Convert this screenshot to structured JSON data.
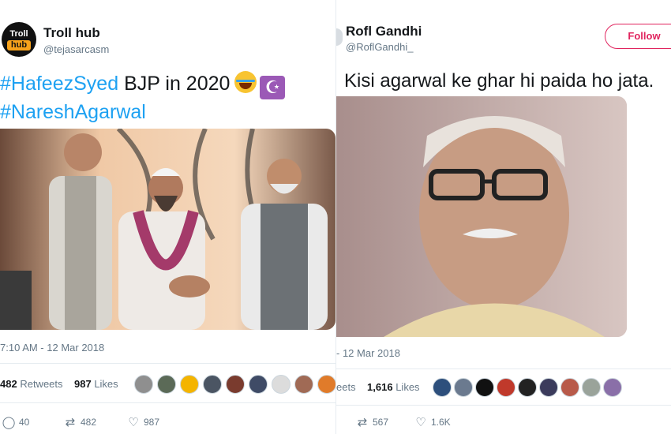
{
  "left_tweet": {
    "user_name": "Troll hub",
    "handle": "@tejasarcasm",
    "avatar_top_text": "Troll",
    "avatar_bottom_text": "hub",
    "hashtag_1": "#HafeezSyed",
    "text_after_hashtag": "BJP in 2020",
    "emoji_1": "face-with-tears-of-joy-icon",
    "emoji_2": "star-and-crescent-icon",
    "hashtag_2": "#NareshAgarwal",
    "timestamp": "7:10 AM - 12 Mar 2018",
    "retweets_count": "482",
    "retweets_label": "Retweets",
    "likes_count": "987",
    "likes_label": "Likes",
    "replies": "40",
    "retweets_action": "482",
    "likes_action": "987"
  },
  "right_tweet": {
    "user_name": "Rofl Gandhi",
    "handle": "@RoflGandhi_",
    "follow_label": "Follow",
    "text": "Kisi agarwal ke ghar hi paida ho jata.",
    "timestamp": "- 12 Mar 2018",
    "retweets_label_partial": "eets",
    "likes_count": "1,616",
    "likes_label": "Likes",
    "retweets_action": "567",
    "likes_action": "1.6K"
  },
  "colors": {
    "link": "#1da1f2",
    "follow": "#e0245e",
    "muted": "#657786",
    "divider": "#e6ecf0"
  },
  "icons": {
    "reply": "reply-icon",
    "retweet": "retweet-icon",
    "like": "heart-icon"
  }
}
